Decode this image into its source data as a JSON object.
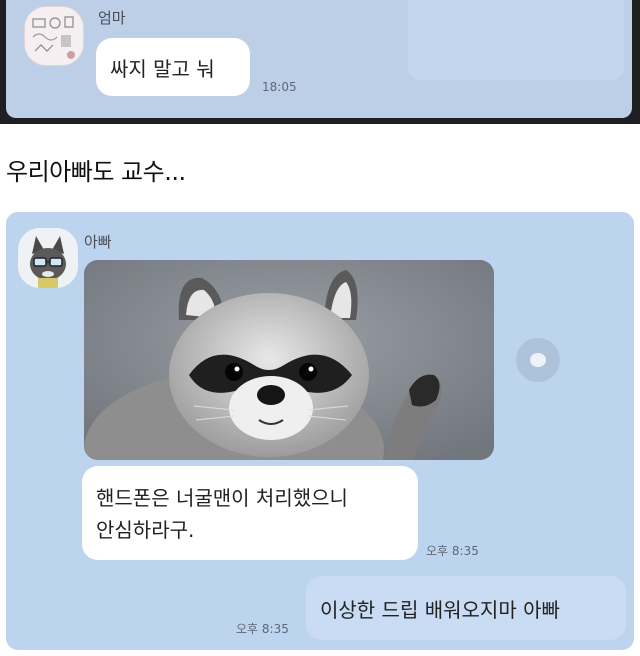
{
  "top_chat": {
    "sender_name": "엄마",
    "message": "싸지 말고 눠",
    "time": "18:05"
  },
  "caption": "우리아빠도 교수...",
  "main_chat": {
    "sender_name": "아빠",
    "message_line1": "핸드폰은 너굴맨이 처리했으니",
    "message_line2": "안심하라구.",
    "message_time": "오후 8:35",
    "reply_message": "이상한 드립 배워오지마 아빠",
    "reply_time": "오후 8:35"
  },
  "colors": {
    "chat_background": "#bcd4ee",
    "received_bubble": "#ffffff",
    "sent_bubble": "#c9dcf3",
    "top_frame": "#1e1f22"
  },
  "icons": {
    "share": "speech-bubble-icon",
    "dad_avatar": "cartoon-cat-avatar",
    "mom_avatar": "doodle-avatar"
  }
}
